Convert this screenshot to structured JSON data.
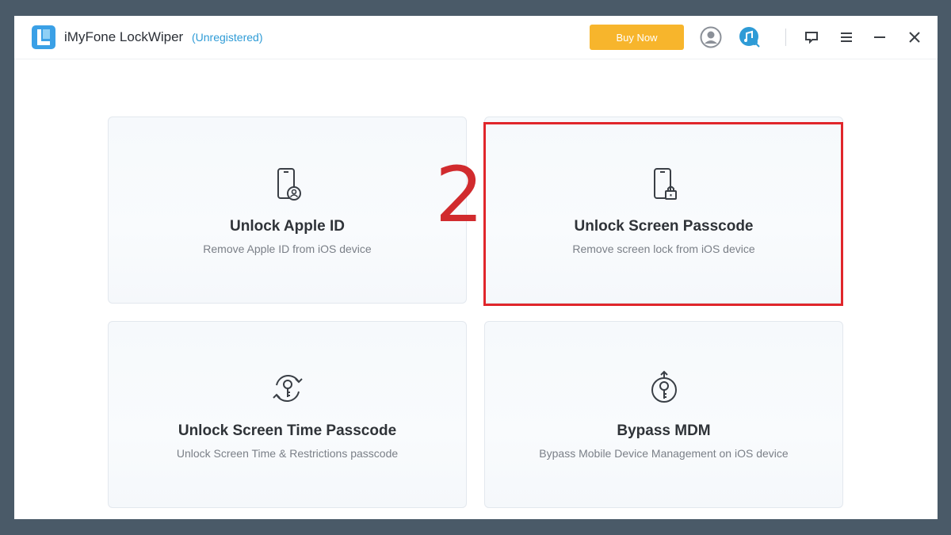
{
  "app": {
    "name": "iMyFone LockWiper",
    "registration_status": "(Unregistered)"
  },
  "titlebar": {
    "buy_label": "Buy Now",
    "icons": [
      "user-account-icon",
      "music-search-icon",
      "feedback-icon",
      "menu-icon",
      "minimize-icon",
      "close-icon"
    ]
  },
  "annotation": {
    "step_number": "2",
    "highlight_color": "#e0262b"
  },
  "colors": {
    "buy_button": "#f7b52c",
    "registration_link": "#2e9bd6"
  },
  "cards": [
    {
      "title": "Unlock Apple ID",
      "description": "Remove Apple ID from iOS device",
      "icon": "phone-user-icon"
    },
    {
      "title": "Unlock Screen Passcode",
      "description": "Remove screen lock from iOS device",
      "icon": "phone-lock-icon"
    },
    {
      "title": "Unlock Screen Time Passcode",
      "description": "Unlock Screen Time & Restrictions passcode",
      "icon": "key-cycle-icon"
    },
    {
      "title": "Bypass MDM",
      "description": "Bypass Mobile Device Management on iOS device",
      "icon": "key-bypass-icon"
    }
  ]
}
